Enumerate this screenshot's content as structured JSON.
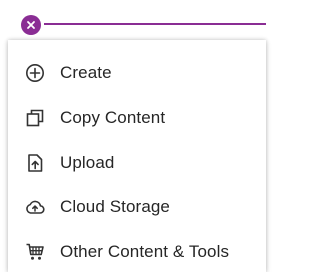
{
  "colors": {
    "accent": "#8a2d94",
    "text": "#262626",
    "icon": "#333333"
  },
  "add_menu": {
    "close_icon": "close-icon",
    "items": [
      {
        "label": "Create",
        "icon": "plus-circle-icon"
      },
      {
        "label": "Copy Content",
        "icon": "copy-icon"
      },
      {
        "label": "Upload",
        "icon": "upload-icon"
      },
      {
        "label": "Cloud Storage",
        "icon": "cloud-upload-icon"
      },
      {
        "label": "Other Content & Tools",
        "icon": "tools-cart-icon"
      }
    ]
  }
}
